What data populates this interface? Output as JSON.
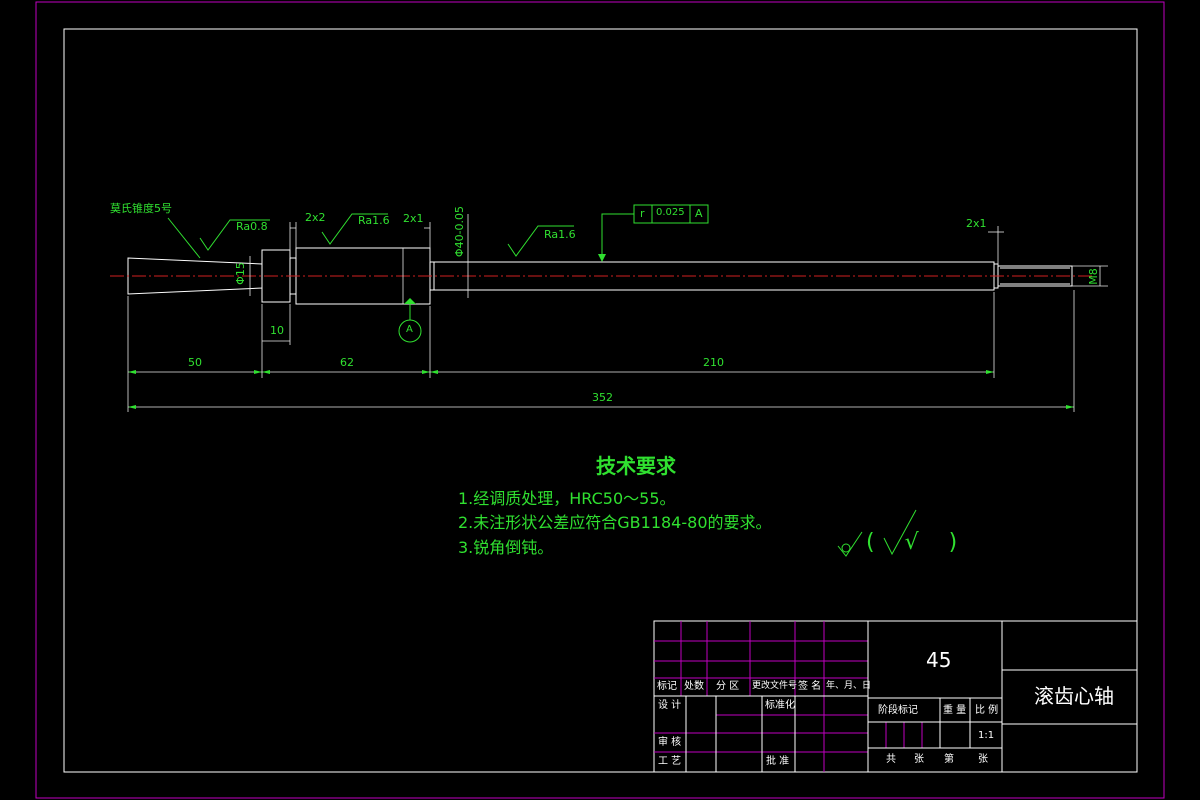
{
  "shaft": {
    "center_hole_note": "莫氏锥度5号",
    "roughness": [
      "Ra0.8",
      "Ra1.6",
      "Ra1.6"
    ],
    "chamfers": [
      "2x2",
      "2x1",
      "2x1"
    ],
    "groove_width": "10",
    "diameters": [
      "Φ15",
      "Φ40-0.05",
      "M8"
    ],
    "datum": "A",
    "tolerance": {
      "symbol": "r",
      "value": "0.025",
      "datum": "A"
    }
  },
  "dimensions": {
    "seg1": "50",
    "seg2": "62",
    "seg3": "210",
    "total": "352"
  },
  "tech": {
    "title": "技术要求",
    "items": [
      "1.经调质处理，HRC50～55。",
      "2.未注形状公差应符合GB1184-80的要求。",
      "3.锐角倒钝。"
    ],
    "roughness_note": "(√)"
  },
  "title_block": {
    "rev_headers": [
      "标记",
      "处数",
      "分 区",
      "更改文件号",
      "签 名",
      "年、月、日"
    ],
    "design": "设 计",
    "standardize": "标准化",
    "review": "审 核",
    "process": "工 艺",
    "approve": "批 准",
    "material": "45",
    "stage_mark": "阶段标记",
    "weight": "重 量",
    "scale_label": "比 例",
    "scale": "1:1",
    "total_sheets": "共",
    "sheet": "张",
    "sheet_no": "第",
    "sheet2": "张",
    "part_name": "滚齿心轴"
  }
}
